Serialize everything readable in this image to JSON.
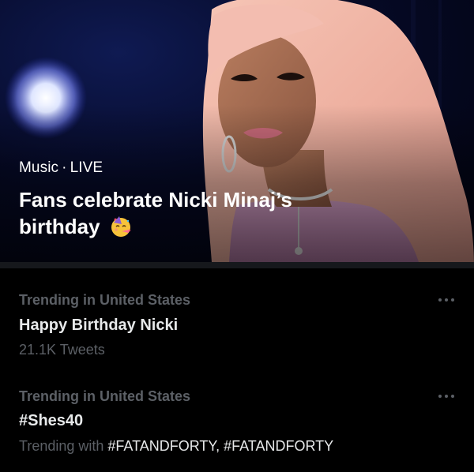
{
  "hero": {
    "category": "Music",
    "separator": "·",
    "status": "LIVE",
    "headline_line1": "Fans celebrate Nicki Minaj’s",
    "headline_line2": "birthday",
    "emoji": "partying-face-icon"
  },
  "trends": [
    {
      "context": "Trending in United States",
      "title": "Happy Birthday Nicki",
      "subtitle": "21.1K Tweets"
    },
    {
      "context": "Trending in United States",
      "title": "#Shes40",
      "subtitle_prefix": "Trending with",
      "tags": "#FATANDFORTY, #FATANDFORTY"
    }
  ],
  "colors": {
    "background": "#000000",
    "primary_text": "#e7e9ea",
    "secondary_text": "#5c6066",
    "hair": "#f2b6a8"
  }
}
